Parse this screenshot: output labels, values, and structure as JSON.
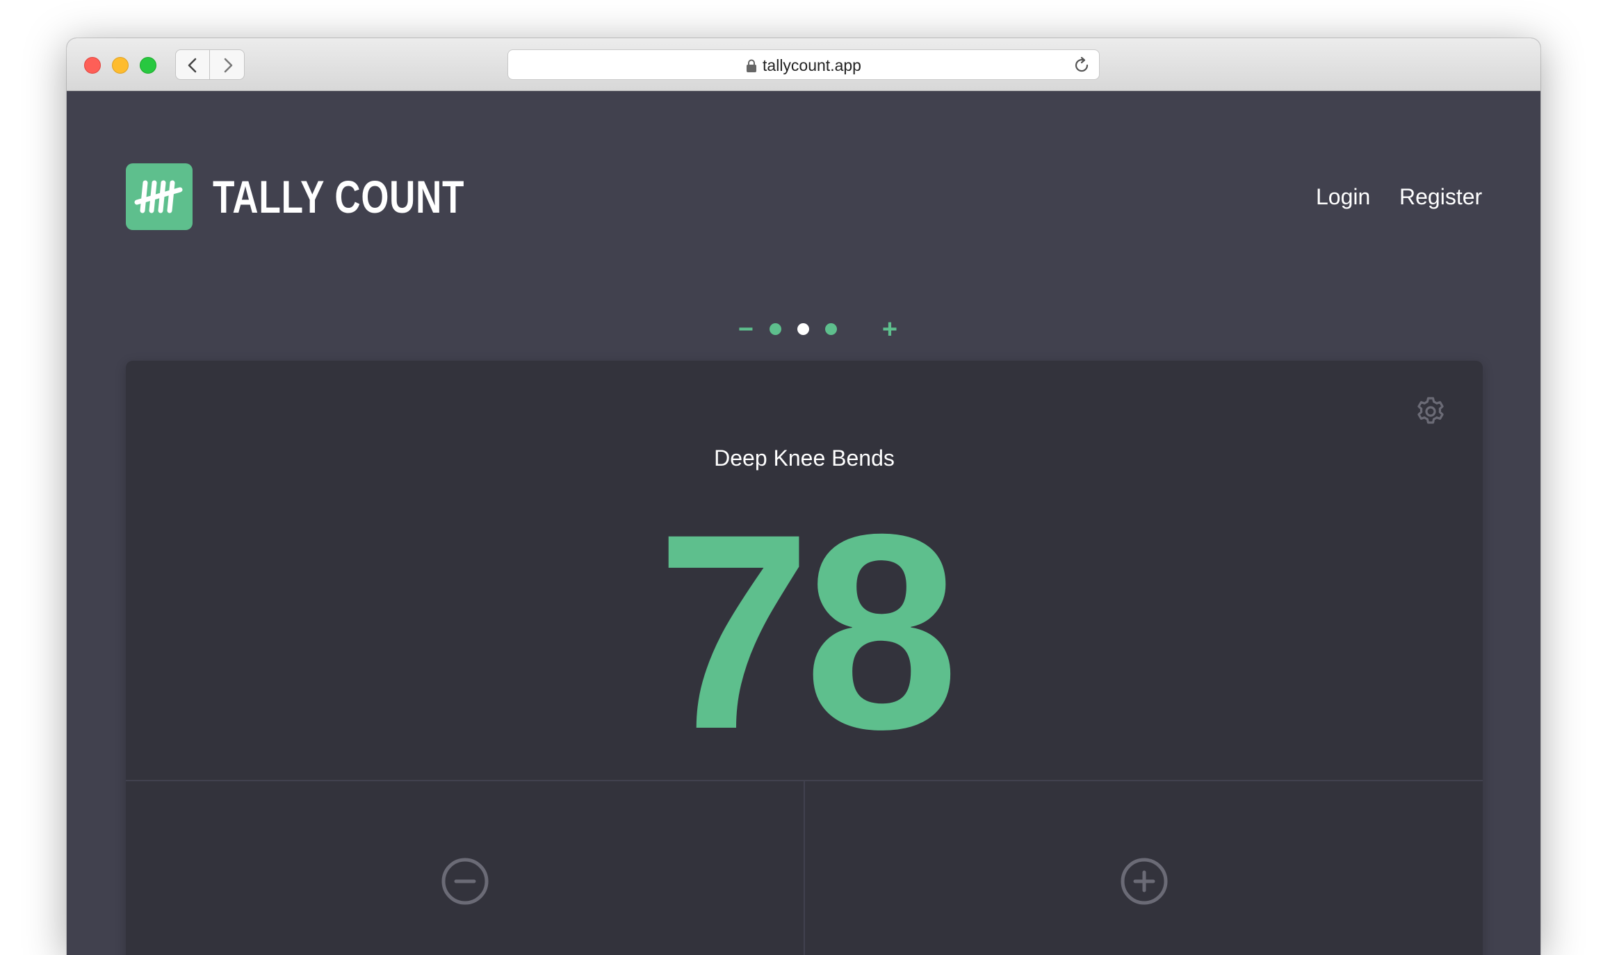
{
  "browser": {
    "url": "tallycount.app"
  },
  "app": {
    "brand": "TALLY COUNT",
    "nav": {
      "login": "Login",
      "register": "Register"
    }
  },
  "pager": {
    "minus": "−",
    "plus": "+",
    "pages": 3,
    "active_page": 2
  },
  "counter": {
    "name": "Deep Knee Bends",
    "value": "78"
  },
  "colors": {
    "accent": "#5ebf8d",
    "background": "#41414e",
    "card": "#33333c",
    "icon_muted": "#6b6b76"
  },
  "icons": {
    "settings": "gear-icon",
    "decrement": "minus-circle-icon",
    "increment": "plus-circle-icon",
    "logo": "tally-marks-icon"
  }
}
